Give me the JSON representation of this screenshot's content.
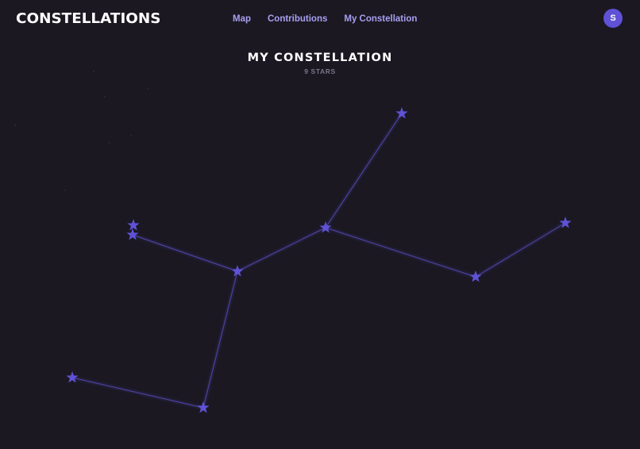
{
  "header": {
    "logo": "CONSTELLATIONS",
    "nav": [
      {
        "label": "Map"
      },
      {
        "label": "Contributions"
      },
      {
        "label": "My Constellation"
      }
    ],
    "avatar_initial": "S"
  },
  "page": {
    "title": "MY CONSTELLATION",
    "subtitle": "9 STARS"
  },
  "colors": {
    "background": "#1b1822",
    "accent": "#5f52d6",
    "nav_link": "#a79ff0",
    "line": "#5448b8"
  }
}
